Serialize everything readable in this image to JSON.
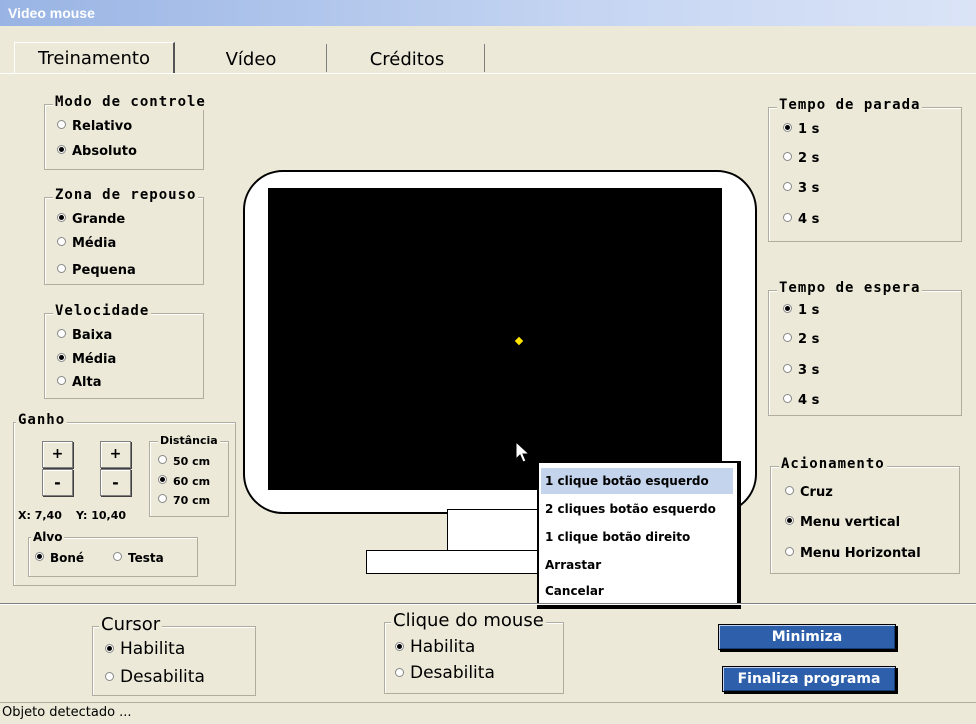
{
  "window": {
    "title": "Video mouse"
  },
  "tabs": [
    {
      "label": "Treinamento",
      "active": true
    },
    {
      "label": "Vídeo",
      "active": false
    },
    {
      "label": "Créditos",
      "active": false
    }
  ],
  "modo_controle": {
    "title": "Modo de controle",
    "options": [
      "Relativo",
      "Absoluto"
    ],
    "selected": "Absoluto"
  },
  "zona_repouso": {
    "title": "Zona de repouso",
    "options": [
      "Grande",
      "Média",
      "Pequena"
    ],
    "selected": "Grande"
  },
  "velocidade": {
    "title": "Velocidade",
    "options": [
      "Baixa",
      "Média",
      "Alta"
    ],
    "selected": "Média"
  },
  "ganho": {
    "title": "Ganho",
    "plus_label": "+",
    "minus_label": "-",
    "x_readout": "X: 7,40",
    "y_readout": "Y: 10,40",
    "distancia": {
      "title": "Distância",
      "options": [
        "50 cm",
        "60 cm",
        "70 cm"
      ],
      "selected": "60 cm"
    },
    "alvo": {
      "title": "Alvo",
      "options": [
        "Boné",
        "Testa"
      ],
      "selected": "Boné"
    }
  },
  "tempo_parada": {
    "title": "Tempo de parada",
    "options": [
      "1 s",
      "2 s",
      "3 s",
      "4 s"
    ],
    "selected": "1 s"
  },
  "tempo_espera": {
    "title": "Tempo de espera",
    "options": [
      "1 s",
      "2 s",
      "3 s",
      "4 s"
    ],
    "selected": "1 s"
  },
  "acionamento": {
    "title": "Acionamento",
    "options": [
      "Cruz",
      "Menu vertical",
      "Menu Horizontal"
    ],
    "selected": "Menu vertical"
  },
  "context_menu": {
    "items": [
      "1 clique botão esquerdo",
      "2 cliques botão esquerdo",
      "1 clique botão direito",
      "Arrastar",
      "Cancelar"
    ],
    "highlighted": "1 clique botão esquerdo"
  },
  "cursor": {
    "title": "Cursor",
    "options": [
      "Habilita",
      "Desabilita"
    ],
    "selected": "Habilita"
  },
  "clique_mouse": {
    "title": "Clique do mouse",
    "options": [
      "Habilita",
      "Desabilita"
    ],
    "selected": "Habilita"
  },
  "buttons": {
    "minimiza": "Minimiza",
    "finaliza": "Finaliza programa"
  },
  "colors": {
    "screen": "#000000",
    "target_dot": "#ffe400",
    "accent_button": "#2e5faa",
    "menu_highlight": "#c4d4ec"
  },
  "status_bar": {
    "text": "Objeto detectado ..."
  }
}
